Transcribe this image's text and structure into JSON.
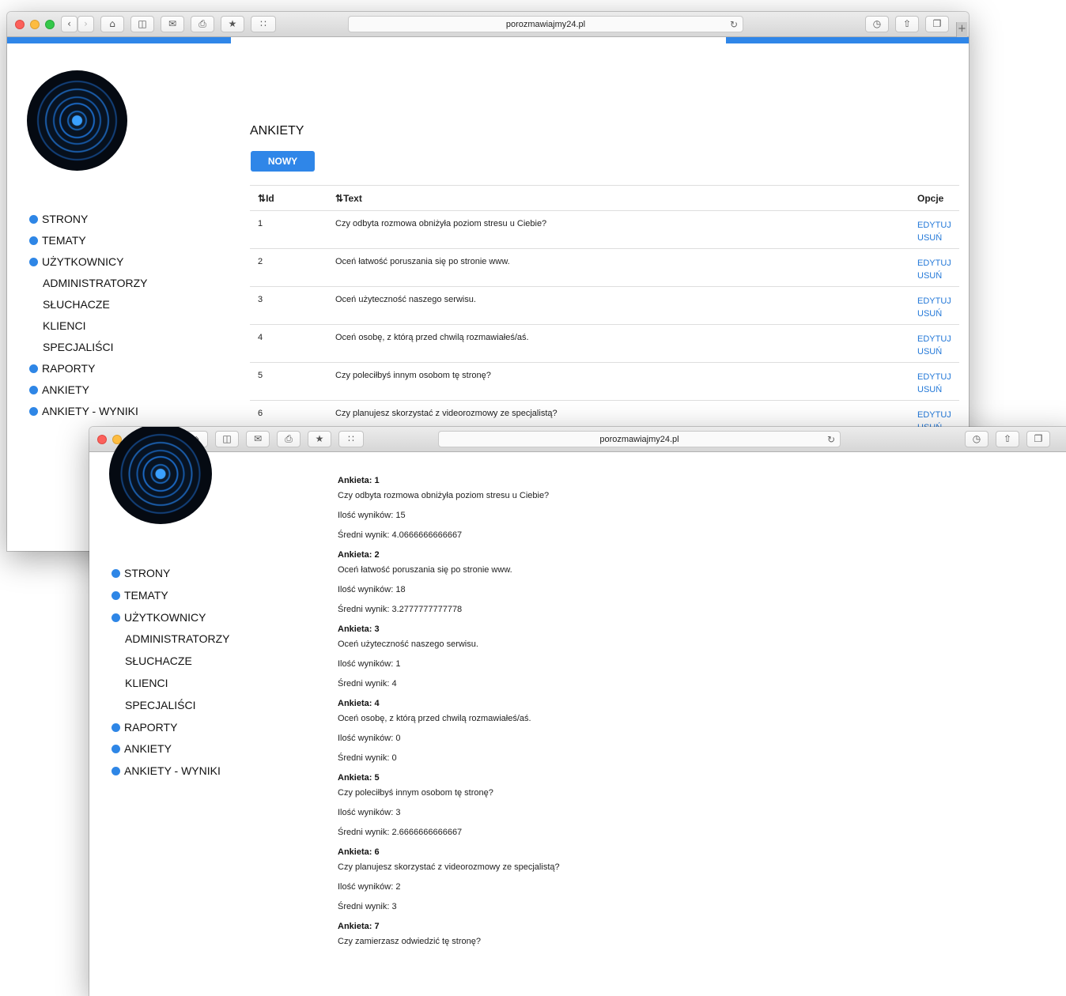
{
  "browser": {
    "url": "porozmawiajmy24.pl",
    "plus_label": "+",
    "reload_icon": "reload-icon"
  },
  "sidebar": {
    "items": [
      {
        "label": "STRONY",
        "bullet": true
      },
      {
        "label": "TEMATY",
        "bullet": true
      },
      {
        "label": "UŻYTKOWNICY",
        "bullet": true
      },
      {
        "label": "ADMINISTRATORZY",
        "bullet": false
      },
      {
        "label": "SŁUCHACZE",
        "bullet": false
      },
      {
        "label": "KLIENCI",
        "bullet": false
      },
      {
        "label": "SPECJALIŚCI",
        "bullet": false
      },
      {
        "label": "RAPORTY",
        "bullet": true
      },
      {
        "label": "ANKIETY",
        "bullet": true
      },
      {
        "label": "ANKIETY - WYNIKI",
        "bullet": true
      }
    ]
  },
  "surveys": {
    "title": "ANKIETY",
    "new_button": "NOWY",
    "columns": {
      "id": "Id",
      "text": "Text",
      "options": "Opcje"
    },
    "edit_label": "EDYTUJ",
    "delete_label": "USUŃ",
    "rows": [
      {
        "id": "1",
        "text": "Czy odbyta rozmowa obniżyła poziom stresu u Ciebie?"
      },
      {
        "id": "2",
        "text": "Oceń łatwość poruszania się po stronie www."
      },
      {
        "id": "3",
        "text": "Oceń użyteczność naszego serwisu."
      },
      {
        "id": "4",
        "text": "Oceń osobę, z którą przed chwilą rozmawiałeś/aś."
      },
      {
        "id": "5",
        "text": "Czy poleciłbyś innym osobom tę stronę?"
      },
      {
        "id": "6",
        "text": "Czy planujesz skorzystać z videorozmowy ze specjalistą?"
      }
    ]
  },
  "results": {
    "items": [
      {
        "heading": "Ankieta: 1",
        "question": "Czy odbyta rozmowa obniżyła poziom stresu u Ciebie?",
        "count": "Ilość wyników: 15",
        "avg": "Średni wynik: 4.0666666666667"
      },
      {
        "heading": "Ankieta: 2",
        "question": "Oceń łatwość poruszania się po stronie www.",
        "count": "Ilość wyników: 18",
        "avg": "Średni wynik: 3.2777777777778"
      },
      {
        "heading": "Ankieta: 3",
        "question": "Oceń użyteczność naszego serwisu.",
        "count": "Ilość wyników: 1",
        "avg": "Średni wynik: 4"
      },
      {
        "heading": "Ankieta: 4",
        "question": "Oceń osobę, z którą przed chwilą rozmawiałeś/aś.",
        "count": "Ilość wyników: 0",
        "avg": "Średni wynik: 0"
      },
      {
        "heading": "Ankieta: 5",
        "question": "Czy poleciłbyś innym osobom tę stronę?",
        "count": "Ilość wyników: 3",
        "avg": "Średni wynik: 2.6666666666667"
      },
      {
        "heading": "Ankieta: 6",
        "question": "Czy planujesz skorzystać z videorozmowy ze specjalistą?",
        "count": "Ilość wyników: 2",
        "avg": "Średni wynik: 3"
      },
      {
        "heading": "Ankieta: 7",
        "question": "Czy zamierzasz odwiedzić tę stronę?",
        "count": "",
        "avg": ""
      }
    ]
  },
  "colors": {
    "accent": "#2f86e8",
    "link": "#2378d8"
  }
}
